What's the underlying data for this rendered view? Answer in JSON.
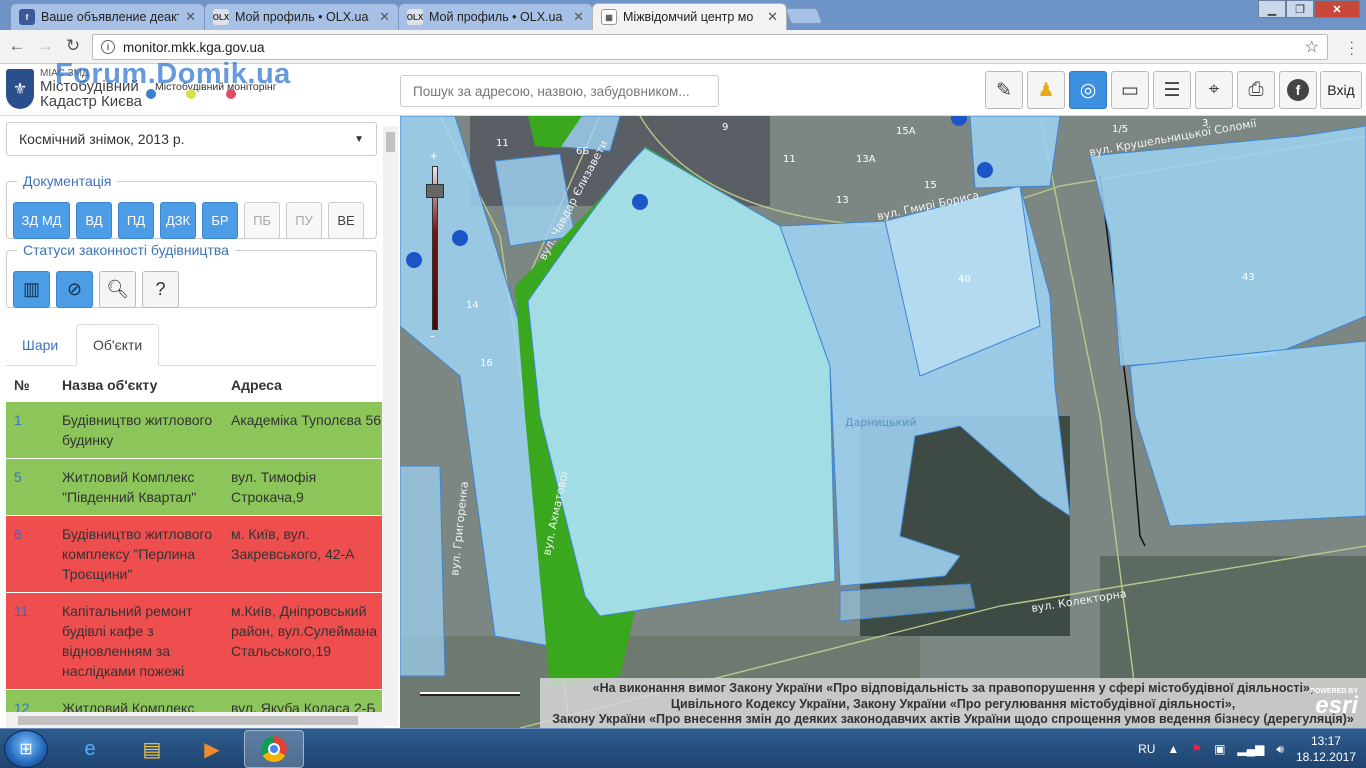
{
  "browser": {
    "tabs": [
      {
        "title": "Ваше объявление деакт",
        "favicon": "f",
        "favicon_color": "#3b5998"
      },
      {
        "title": "Мой профиль • OLX.ua",
        "favicon": "OLX",
        "favicon_color": "#dde3e8"
      },
      {
        "title": "Мой профиль • OLX.ua",
        "favicon": "OLX",
        "favicon_color": "#dde3e8"
      },
      {
        "title": "Міжвідомчий центр мо",
        "favicon": "▦",
        "favicon_color": "#ffffff"
      }
    ],
    "active_tab": 3,
    "url": "monitor.mkk.kga.gov.ua"
  },
  "header": {
    "brand_small": "МІАС ЗМД",
    "brand_line1": "Містобудівний",
    "brand_line2": "Кадастр Києва",
    "brand_sub": "Містобудівний моніторінг",
    "watermark": "Forum.Domik.ua",
    "search_placeholder": "Пошук за адресою, назвою, забудовником...",
    "login_label": "Вхід",
    "tools": [
      "edit-icon",
      "person-icon",
      "compass-icon",
      "ruler-icon",
      "layers-icon",
      "locate-icon",
      "print-icon",
      "info-icon"
    ]
  },
  "sidebar": {
    "basemap": "Космічний знімок, 2013 р.",
    "documentation": {
      "title": "Документація",
      "buttons": [
        {
          "label": "ЗД МД",
          "active": true
        },
        {
          "label": "ВД",
          "active": true
        },
        {
          "label": "ПД",
          "active": true
        },
        {
          "label": "ДЗК",
          "active": true
        },
        {
          "label": "БР",
          "active": true
        },
        {
          "label": "ПБ",
          "active": false
        },
        {
          "label": "ПУ",
          "active": false
        },
        {
          "label": "ВЕ",
          "active": false
        }
      ]
    },
    "statuses": {
      "title": "Статуси законності будівництва",
      "buttons": [
        "crane-icon",
        "no-build-icon",
        "search-icon",
        "question-search-icon"
      ]
    },
    "tabs": [
      "Шари",
      "Об'єкти"
    ],
    "table": {
      "headers": [
        "№",
        "Назва об'єкту",
        "Адреса"
      ],
      "rows": [
        {
          "num": "1",
          "name": "Будівництво житлового будинку",
          "address": "Академіка Туполєва 56",
          "status": "green"
        },
        {
          "num": "5",
          "name": "Житловий Комплекс \"Південний Квартал\"",
          "address": "вул. Тимофія Строкача,9",
          "status": "green"
        },
        {
          "num": "6",
          "name": "Будівництво житлового комплексу \"Перлина Троєщини\"",
          "address": "м. Київ, вул. Закревського, 42-А",
          "status": "red"
        },
        {
          "num": "11",
          "name": "Капітальний ремонт будівлі кафе з відновленням за наслідками пожежі",
          "address": "м.Київ, Дніпровський район, вул.Сулеймана Стальського,19",
          "status": "red"
        },
        {
          "num": "12",
          "name": "Житловий Комплекс",
          "address": "вул. Якуба Коласа 2-Б",
          "status": "green"
        }
      ]
    }
  },
  "map": {
    "streets": [
      "вул. Чавдар Єлизавети",
      "вул. Гмирі Бориса",
      "вул. Крушельницької Соломії",
      "вул. Колекторна",
      "вул. Ахматової",
      "вул. Григоренка"
    ],
    "district_label": "Дарницький",
    "building_numbers": [
      "11",
      "6Б",
      "9",
      "11",
      "13А",
      "15А",
      "13",
      "15",
      "1/5",
      "3",
      "40",
      "43",
      "14",
      "16"
    ],
    "disclaimer": [
      "«На виконання вимог Закону України «Про відповідальність за правопорушення у сфері містобудівної діяльності»,",
      "Цивільного Кодексу України, Закону України «Про регулювання містобудівної діяльності»,",
      "Закону України «Про внесення змін до деяких законодавчих актів України щодо спрощення умов ведення бізнесу (дерегуляція)»"
    ],
    "esri_powered": "POWERED BY",
    "esri_name": "esri"
  },
  "taskbar": {
    "lang": "RU",
    "time": "13:17",
    "date": "18.12.2017"
  },
  "colors": {
    "accent": "#4d9de6",
    "status_green": "#8cc65a",
    "status_red": "#ee4e4e",
    "parcel_fill": "#9fd4f5",
    "parcel_green": "#3aa81e"
  }
}
